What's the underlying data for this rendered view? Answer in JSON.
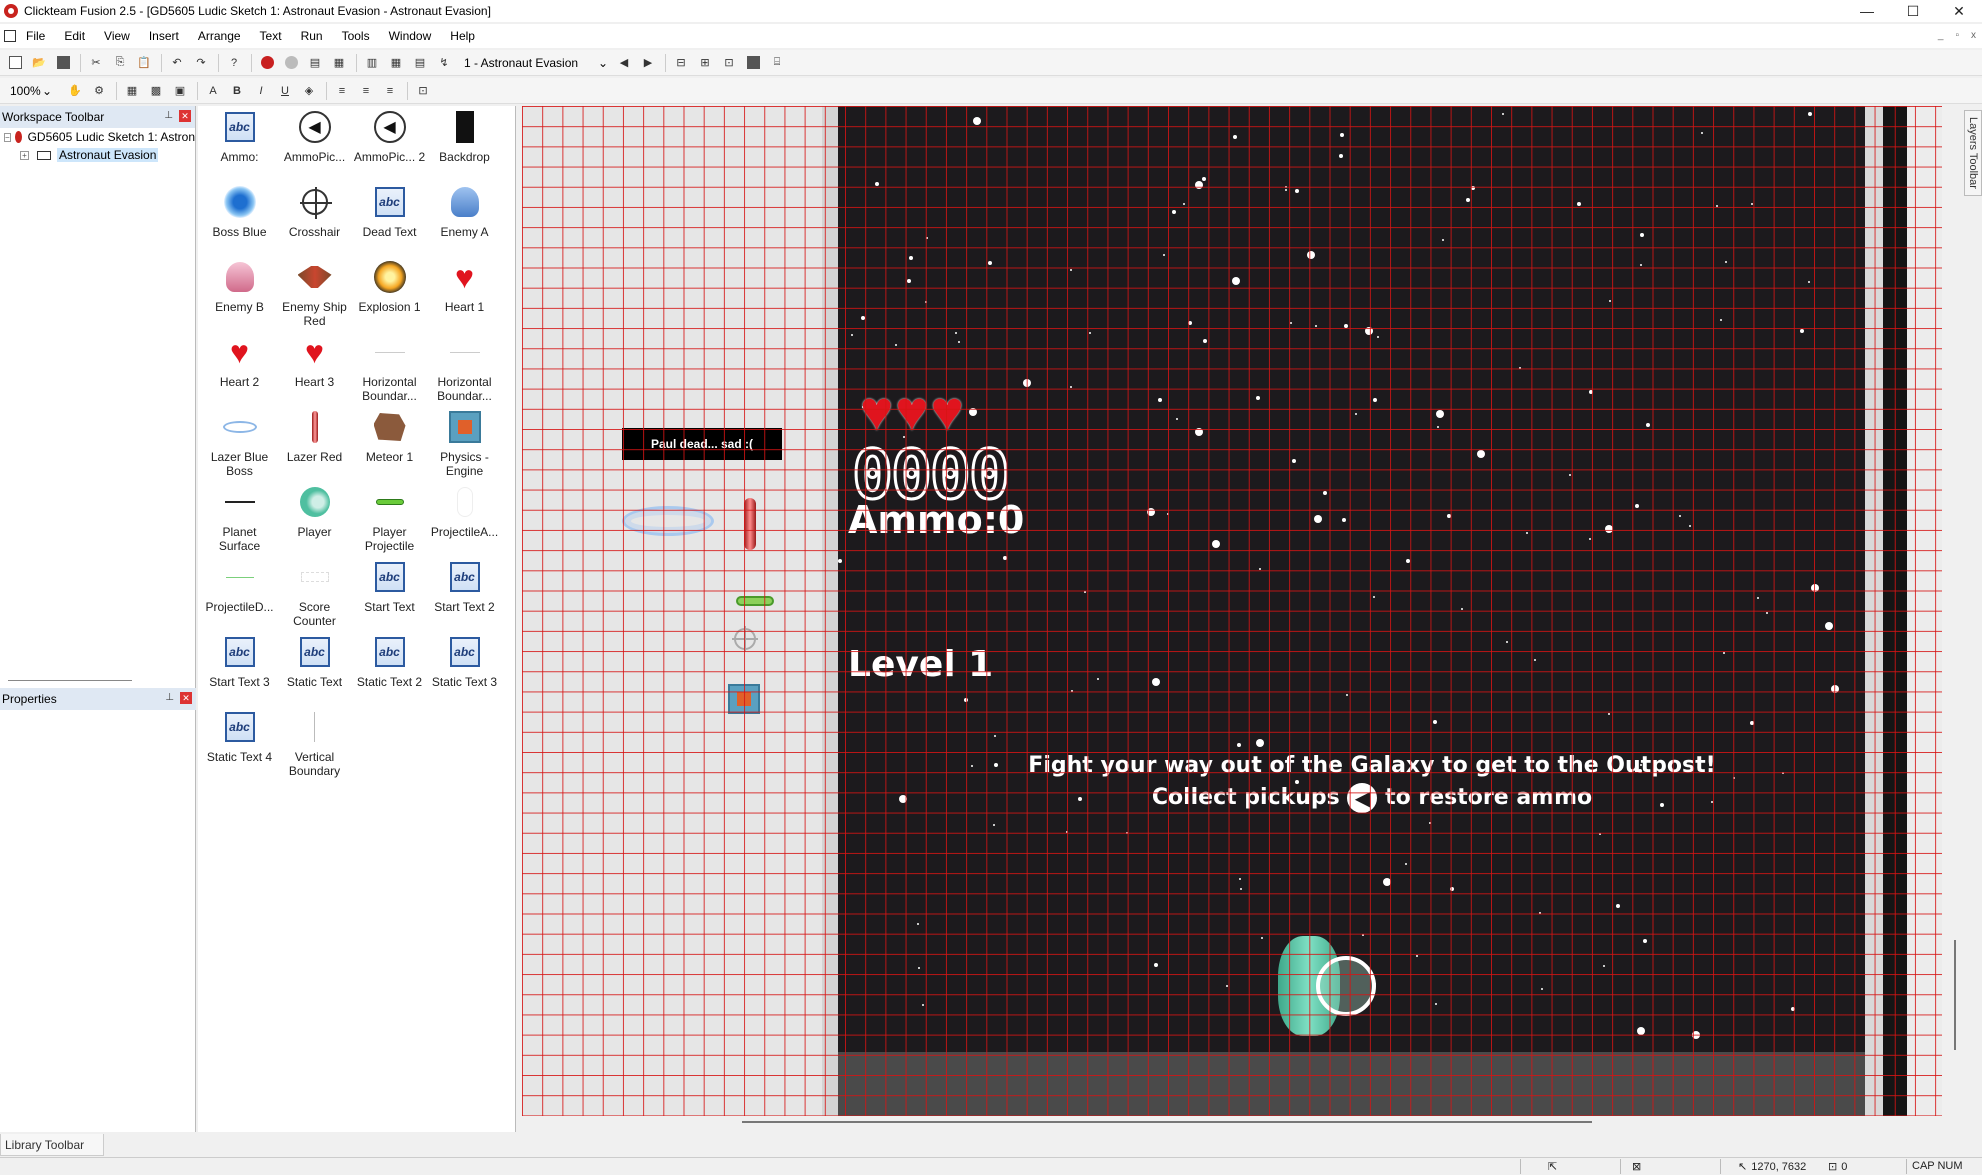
{
  "window": {
    "title": "Clickteam Fusion 2.5 - [GD5605 Ludic Sketch 1: Astronaut Evasion - Astronaut Evasion]",
    "controls": [
      "—",
      "☐",
      "✕"
    ]
  },
  "menu": {
    "items": [
      "File",
      "Edit",
      "View",
      "Insert",
      "Arrange",
      "Text",
      "Run",
      "Tools",
      "Window",
      "Help"
    ],
    "mdi_controls": [
      "_",
      "▫",
      "x"
    ]
  },
  "toolbar": {
    "frame_select": "1 - Astronaut Evasion",
    "zoom": "100%"
  },
  "workspace": {
    "header": "Workspace Toolbar",
    "tree": [
      {
        "label": "GD5605 Ludic Sketch 1: Astron"
      },
      {
        "label": "Astronaut Evasion"
      }
    ],
    "properties_header": "Properties"
  },
  "library": {
    "objects": [
      {
        "label": "Ammo:",
        "icon": "text-abc-icon"
      },
      {
        "label": "AmmoPic...",
        "icon": "ammo-pickup-icon"
      },
      {
        "label": "AmmoPic... 2",
        "icon": "ammo-pickup-icon"
      },
      {
        "label": "Backdrop",
        "icon": "backdrop-icon"
      },
      {
        "label": "Boss Blue",
        "icon": "boss-blue-icon"
      },
      {
        "label": "Crosshair",
        "icon": "crosshair-icon"
      },
      {
        "label": "Dead Text",
        "icon": "text-abc-icon"
      },
      {
        "label": "Enemy A",
        "icon": "enemy-a-icon"
      },
      {
        "label": "Enemy B",
        "icon": "enemy-b-icon"
      },
      {
        "label": "Enemy Ship Red",
        "icon": "enemy-ship-red-icon"
      },
      {
        "label": "Explosion 1",
        "icon": "explosion-icon"
      },
      {
        "label": "Heart 1",
        "icon": "heart-icon"
      },
      {
        "label": "Heart 2",
        "icon": "heart-icon"
      },
      {
        "label": "Heart 3",
        "icon": "heart-icon"
      },
      {
        "label": "Horizontal Boundar...",
        "icon": "horizontal-boundary-icon"
      },
      {
        "label": "Horizontal Boundar...",
        "icon": "horizontal-boundary-icon"
      },
      {
        "label": "Lazer Blue Boss",
        "icon": "lazer-blue-icon"
      },
      {
        "label": "Lazer Red",
        "icon": "lazer-red-icon"
      },
      {
        "label": "Meteor 1",
        "icon": "meteor-icon"
      },
      {
        "label": "Physics - Engine",
        "icon": "physics-engine-icon"
      },
      {
        "label": "Planet Surface",
        "icon": "planet-surface-icon"
      },
      {
        "label": "Player",
        "icon": "player-icon"
      },
      {
        "label": "Player Projectile",
        "icon": "player-projectile-icon"
      },
      {
        "label": "ProjectileA...",
        "icon": "projectile-icon"
      },
      {
        "label": "ProjectileD...",
        "icon": "projectile-line-icon"
      },
      {
        "label": "Score Counter",
        "icon": "score-counter-icon"
      },
      {
        "label": "Start Text",
        "icon": "text-abc-icon"
      },
      {
        "label": "Start Text 2",
        "icon": "text-abc-icon"
      },
      {
        "label": "Start Text 3",
        "icon": "text-abc-icon"
      },
      {
        "label": "Static Text",
        "icon": "text-abc-icon"
      },
      {
        "label": "Static Text 2",
        "icon": "text-abc-icon"
      },
      {
        "label": "Static Text 3",
        "icon": "text-abc-icon"
      },
      {
        "label": "Static Text 4",
        "icon": "text-abc-icon"
      },
      {
        "label": "Vertical Boundary",
        "icon": "vertical-boundary-icon"
      }
    ],
    "abc_glyph": "abc",
    "footer_tab": "Library Toolbar"
  },
  "frame": {
    "dead_text": "Paul dead... sad :(",
    "hearts": [
      "♥",
      "♥",
      "♥"
    ],
    "score": "0000",
    "ammo": "Ammo:0",
    "level": "Level 1",
    "instruction_line1": "Fight your way out of the Galaxy to get to the Outpost!",
    "instruction_line2a": "Collect pickups",
    "instruction_line2b": "to restore ammo",
    "ammo_glyph": "◀"
  },
  "layers_tab": "Layers Toolbar",
  "status": {
    "pointer": "1270, 7632",
    "count": "0",
    "keys": "CAP NUM"
  },
  "colors": {
    "grid": "#d61414",
    "stage_bg": "#1c1a1d",
    "heart": "#e0141e",
    "selection": "#cde6fb"
  }
}
